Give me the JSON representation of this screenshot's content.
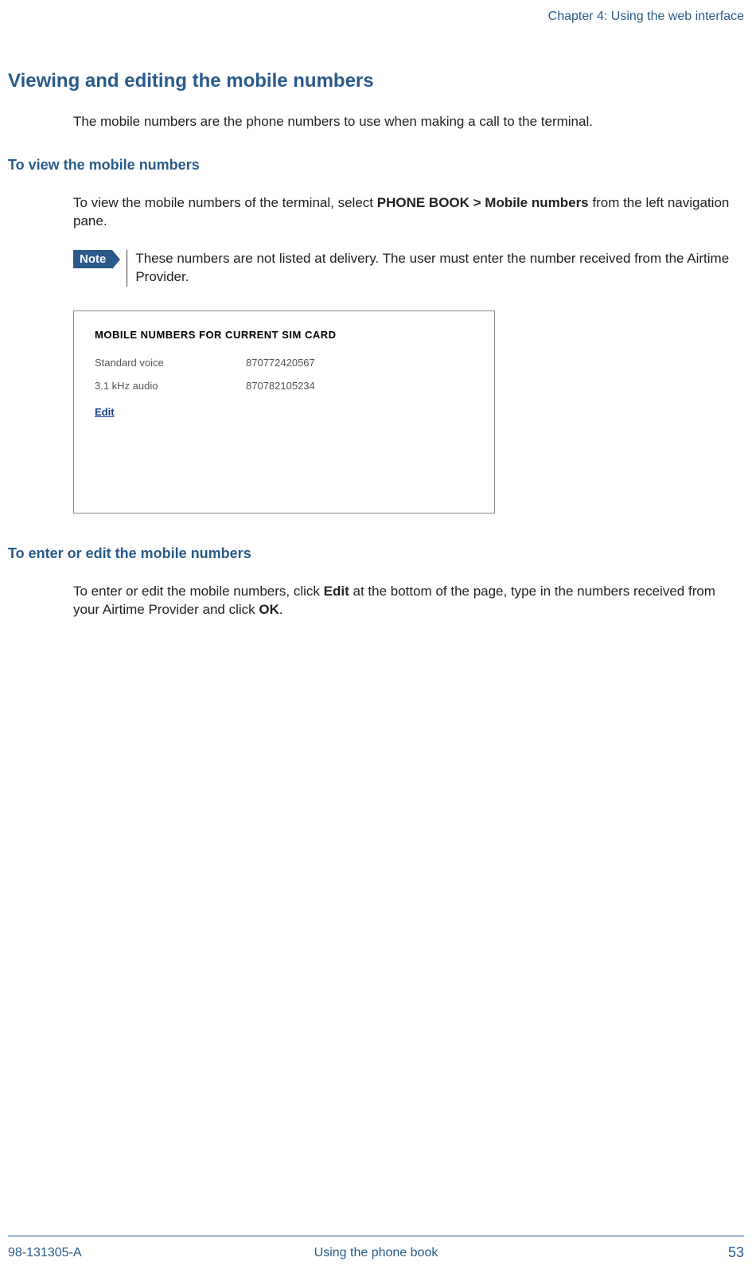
{
  "header": {
    "chapter": "Chapter 4: Using the web interface"
  },
  "section": {
    "title": "Viewing and editing the mobile numbers",
    "intro": "The mobile numbers are the phone numbers to use when making a call to the terminal."
  },
  "sub1": {
    "title": "To view the mobile numbers",
    "text_prefix": "To view the mobile numbers of the terminal, select ",
    "bold1": "PHONE BOOK > Mobile numbers",
    "text_suffix": " from the left navigation pane.",
    "note_label": "Note",
    "note_text": "These numbers are not listed at delivery. The user must enter the number received from the Airtime Provider."
  },
  "screenshot": {
    "title": "MOBILE NUMBERS FOR CURRENT SIM CARD",
    "rows": [
      {
        "label": "Standard voice",
        "value": "870772420567"
      },
      {
        "label": "3.1 kHz audio",
        "value": "870782105234"
      }
    ],
    "edit_link": "Edit"
  },
  "sub2": {
    "title": "To enter or edit the mobile numbers",
    "text_prefix": "To enter or edit the mobile numbers, click ",
    "bold1": "Edit",
    "text_mid": " at the bottom of the page, type in the numbers received from your Airtime Provider and click ",
    "bold2": "OK",
    "text_suffix": "."
  },
  "footer": {
    "doc_id": "98-131305-A",
    "center": "Using the phone book",
    "page": "53"
  }
}
